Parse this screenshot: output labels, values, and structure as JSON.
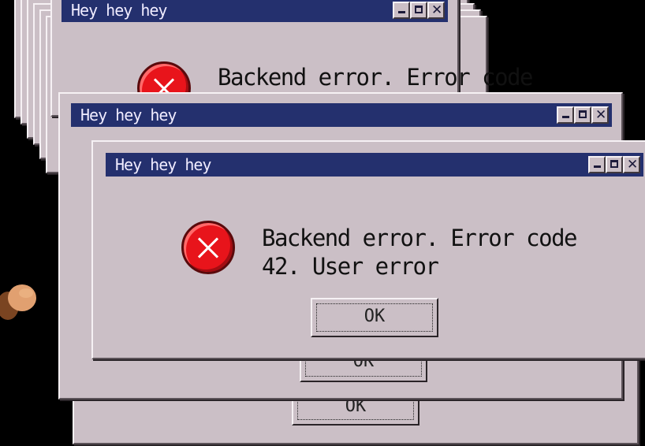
{
  "dialog": {
    "title": "Hey hey hey",
    "message_line1": "Backend error. Error code",
    "message_line2": "42. User error",
    "ok_label": "OK"
  },
  "icons": {
    "error": "error-circle-x-icon",
    "minimize": "minimize-icon",
    "maximize": "maximize-icon",
    "close": "close-icon",
    "pointer": "hand-cursor-icon"
  },
  "colors": {
    "window_bg": "#cbbfc6",
    "titlebar": "#24306e",
    "title_text": "#f0ecff",
    "error_red": "#e8141b",
    "background": "#000000"
  }
}
